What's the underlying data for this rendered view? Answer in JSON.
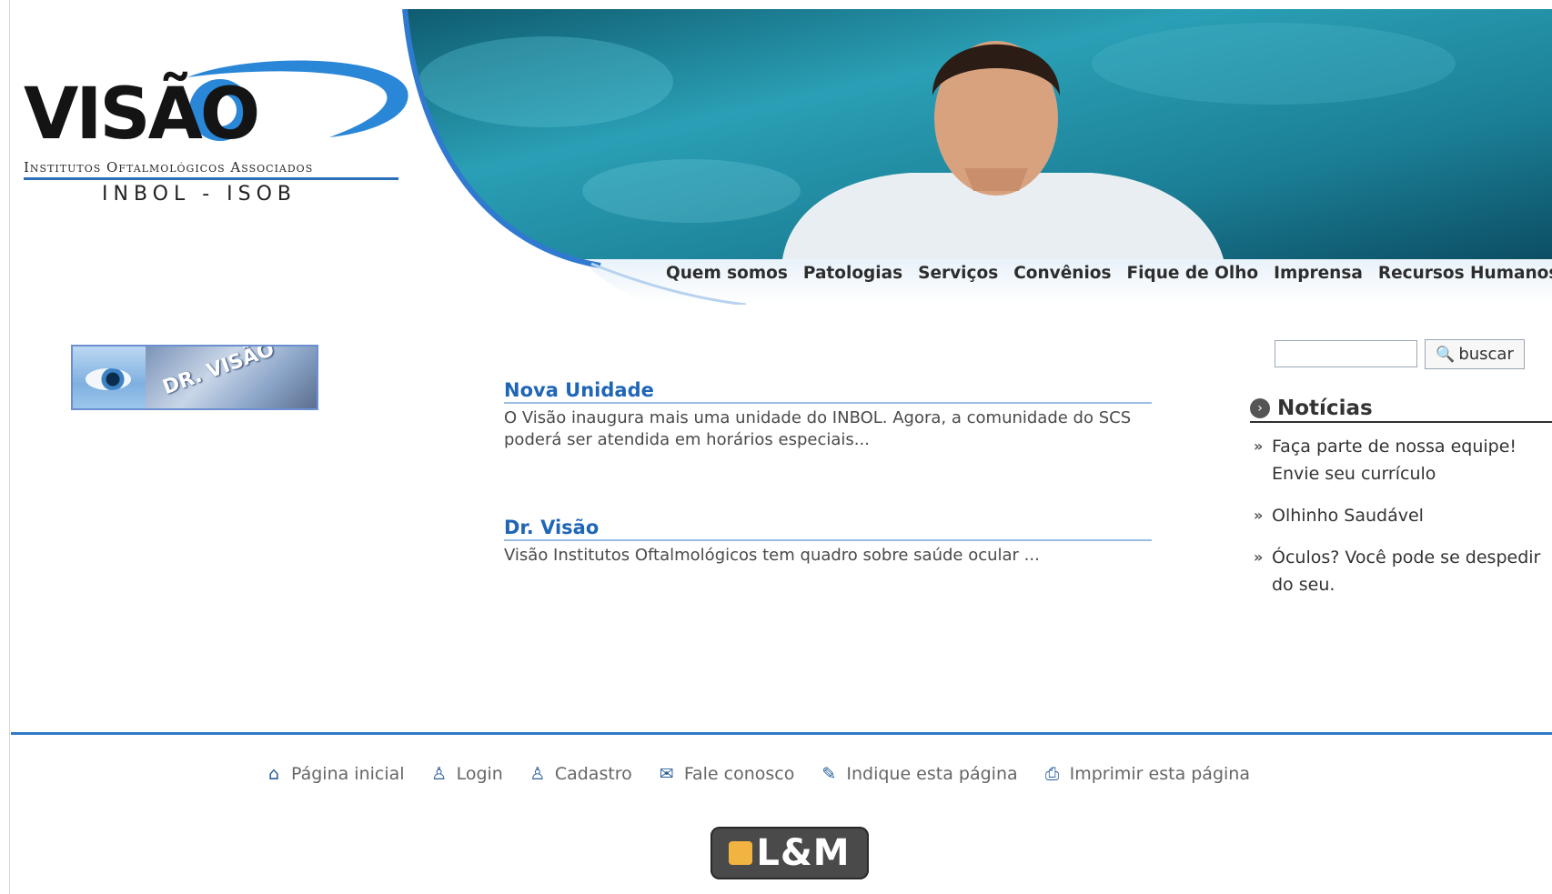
{
  "brand": {
    "logo_word": "VISÃO",
    "logo_subtitle": "Institutos Oftalmológicos Associados",
    "logo_tagline": "INBOL - ISOB",
    "accent_color": "#1f66b6"
  },
  "nav": {
    "items": [
      {
        "label": "Quem somos"
      },
      {
        "label": "Patologias"
      },
      {
        "label": "Serviços"
      },
      {
        "label": "Convênios"
      },
      {
        "label": "Fique de Olho"
      },
      {
        "label": "Imprensa"
      },
      {
        "label": "Recursos Humanos"
      }
    ]
  },
  "promo": {
    "text": "DR. VISÃO"
  },
  "main": {
    "news": [
      {
        "title": "Nova Unidade",
        "text": " O Visão inaugura mais uma unidade do INBOL. Agora, a comunidade do SCS poderá ser atendida em horários especiais..."
      },
      {
        "title": "Dr. Visão",
        "text": " Visão Institutos Oftalmológicos tem quadro sobre saúde ocular ..."
      }
    ]
  },
  "search": {
    "placeholder": "",
    "value": "",
    "button_label": "buscar",
    "button_icon": "search-icon"
  },
  "sidebar": {
    "heading": "Notícias",
    "items": [
      {
        "label": "Faça parte de nossa equipe! Envie seu currículo"
      },
      {
        "label": "Olhinho Saudável"
      },
      {
        "label": "Óculos? Você pode se despedir do seu."
      }
    ]
  },
  "footer": {
    "links": [
      {
        "label": "Página inicial",
        "icon": "home-icon"
      },
      {
        "label": "Login",
        "icon": "user-icon"
      },
      {
        "label": "Cadastro",
        "icon": "register-icon"
      },
      {
        "label": "Fale conosco",
        "icon": "mail-icon"
      },
      {
        "label": "Indique esta página",
        "icon": "recommend-icon"
      },
      {
        "label": "Imprimir esta página",
        "icon": "printer-icon"
      }
    ],
    "partner_logo": "L&M"
  }
}
